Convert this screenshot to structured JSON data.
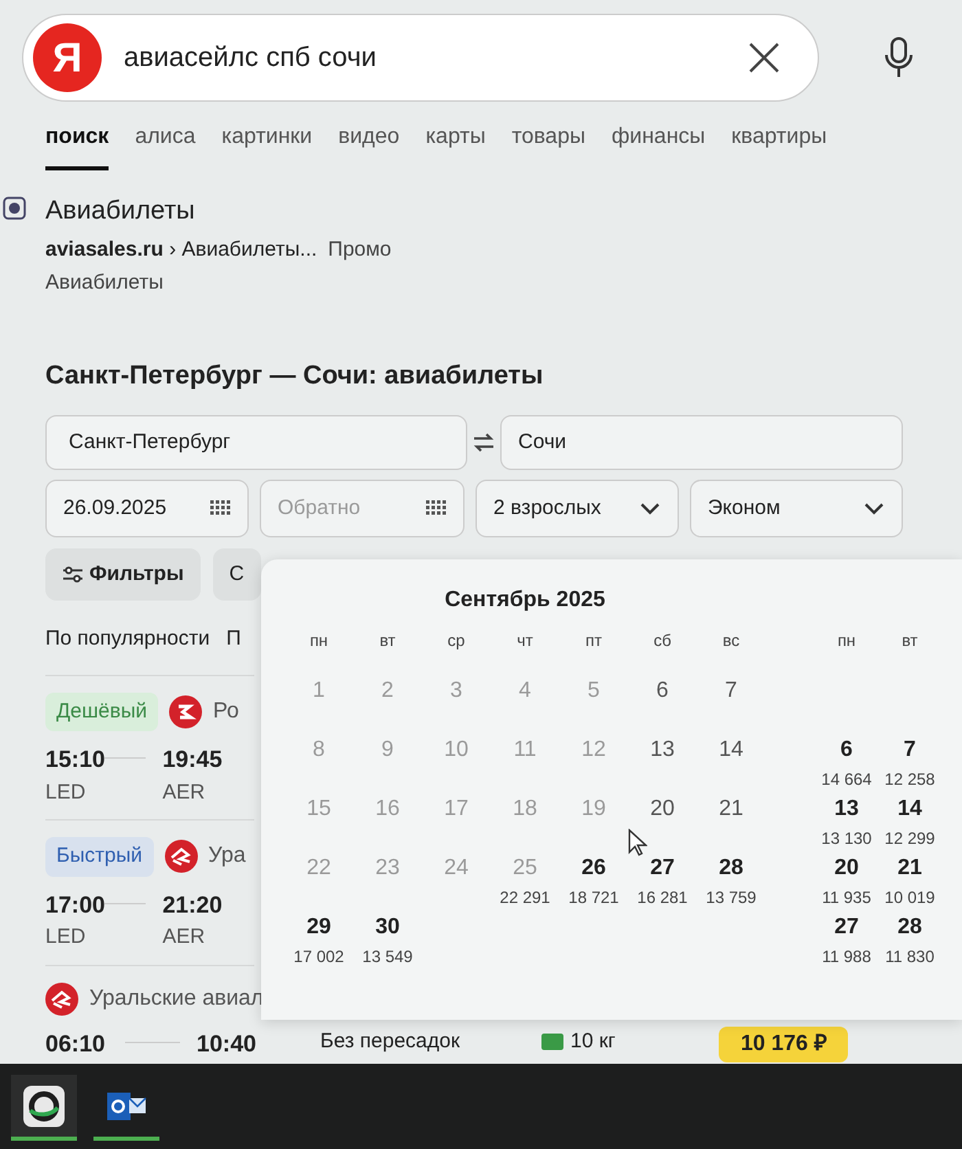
{
  "search": {
    "logo": "Я",
    "query": "авиасейлс спб сочи"
  },
  "tabs": [
    {
      "label": "поиск",
      "selected": true
    },
    {
      "label": "алиса",
      "selected": false
    },
    {
      "label": "картинки",
      "selected": false
    },
    {
      "label": "видео",
      "selected": false
    },
    {
      "label": "карты",
      "selected": false
    },
    {
      "label": "товары",
      "selected": false
    },
    {
      "label": "финансы",
      "selected": false
    },
    {
      "label": "квартиры",
      "selected": false
    }
  ],
  "result": {
    "title": "Авиабилеты",
    "domain": "aviasales.ru",
    "breadcrumb": "› Авиабилеты...",
    "tag": "Промо",
    "subtitle": "Авиабилеты"
  },
  "widget": {
    "title": "Санкт-Петербург — Сочи: авиабилеты",
    "from": "Санкт-Петербург",
    "to": "Сочи",
    "date": "26.09.2025",
    "return_placeholder": "Обратно",
    "passengers": "2 взрослых",
    "cabin": "Эконом",
    "filters": [
      "Фильтры",
      "С"
    ],
    "sort": [
      "По популярности",
      "П"
    ]
  },
  "tickets": [
    {
      "badge": {
        "label": "Дешёвый",
        "kind": "cheap"
      },
      "kind": "rlogo",
      "airline": "Ро",
      "depart": "15:10",
      "from": "LED",
      "arrive": "19:45",
      "to": "AER"
    },
    {
      "badge": {
        "label": "Быстрый",
        "kind": "fast"
      },
      "kind": "swirl",
      "airline": "Ура",
      "depart": "17:00",
      "from": "LED",
      "arrive": "21:20",
      "to": "AER"
    },
    {
      "kind": "swirl",
      "airline": "Уральские авиал",
      "depart": "06:10",
      "arrive": "10:40",
      "stops": "Без пересадок",
      "baggage": "10 кг",
      "price": "10 176 ₽"
    }
  ],
  "calendar": {
    "months": [
      {
        "title": "Сентябрь 2025",
        "weekdays": [
          "пн",
          "вт",
          "ср",
          "чт",
          "пт",
          "сб",
          "вс"
        ],
        "weeks": [
          [
            {
              "day": "1",
              "weekend": false,
              "available": false
            },
            {
              "day": "2",
              "weekend": false,
              "available": false
            },
            {
              "day": "3",
              "weekend": false,
              "available": false
            },
            {
              "day": "4",
              "weekend": false,
              "available": false
            },
            {
              "day": "5",
              "weekend": false,
              "available": false
            },
            {
              "day": "6",
              "weekend": true,
              "available": false
            },
            {
              "day": "7",
              "weekend": true,
              "available": false
            }
          ],
          [
            {
              "day": "8",
              "weekend": false,
              "available": false
            },
            {
              "day": "9",
              "weekend": false,
              "available": false
            },
            {
              "day": "10",
              "weekend": false,
              "available": false
            },
            {
              "day": "11",
              "weekend": false,
              "available": false
            },
            {
              "day": "12",
              "weekend": false,
              "available": false
            },
            {
              "day": "13",
              "weekend": true,
              "available": false
            },
            {
              "day": "14",
              "weekend": true,
              "available": false
            }
          ],
          [
            {
              "day": "15",
              "weekend": false,
              "available": false
            },
            {
              "day": "16",
              "weekend": false,
              "available": false
            },
            {
              "day": "17",
              "weekend": false,
              "available": false
            },
            {
              "day": "18",
              "weekend": false,
              "available": false
            },
            {
              "day": "19",
              "weekend": false,
              "available": false
            },
            {
              "day": "20",
              "weekend": true,
              "available": false
            },
            {
              "day": "21",
              "weekend": true,
              "available": false
            }
          ],
          [
            {
              "day": "22",
              "weekend": false,
              "available": false
            },
            {
              "day": "23",
              "weekend": false,
              "available": false
            },
            {
              "day": "24",
              "weekend": false,
              "available": false
            },
            {
              "day": "25",
              "price": "22 291",
              "weekend": false,
              "available": false
            },
            {
              "day": "26",
              "price": "18 721",
              "available": true
            },
            {
              "day": "27",
              "price": "16 281",
              "available": true
            },
            {
              "day": "28",
              "price": "13 759",
              "available": true
            }
          ],
          [
            {
              "day": "29",
              "price": "17 002",
              "available": true
            },
            {
              "day": "30",
              "price": "13 549",
              "available": true
            }
          ]
        ]
      },
      {
        "weekdays": [
          "пн",
          "вт"
        ],
        "weeks": [
          [
            {
              "day": "6",
              "price": "14 664",
              "available": true
            },
            {
              "day": "7",
              "price": "12 258",
              "available": true
            }
          ],
          [
            {
              "day": "13",
              "price": "13 130",
              "available": true
            },
            {
              "day": "14",
              "price": "12 299",
              "available": true
            }
          ],
          [
            {
              "day": "20",
              "price": "11 935",
              "available": true
            },
            {
              "day": "21",
              "price": "10 019",
              "available": true
            }
          ],
          [
            {
              "day": "27",
              "price": "11 988",
              "available": true
            },
            {
              "day": "28",
              "price": "11 830",
              "available": true
            }
          ]
        ]
      }
    ]
  },
  "taskbar": [
    {
      "kind": "ring",
      "active": true
    },
    {
      "kind": "mail",
      "active": true
    }
  ]
}
